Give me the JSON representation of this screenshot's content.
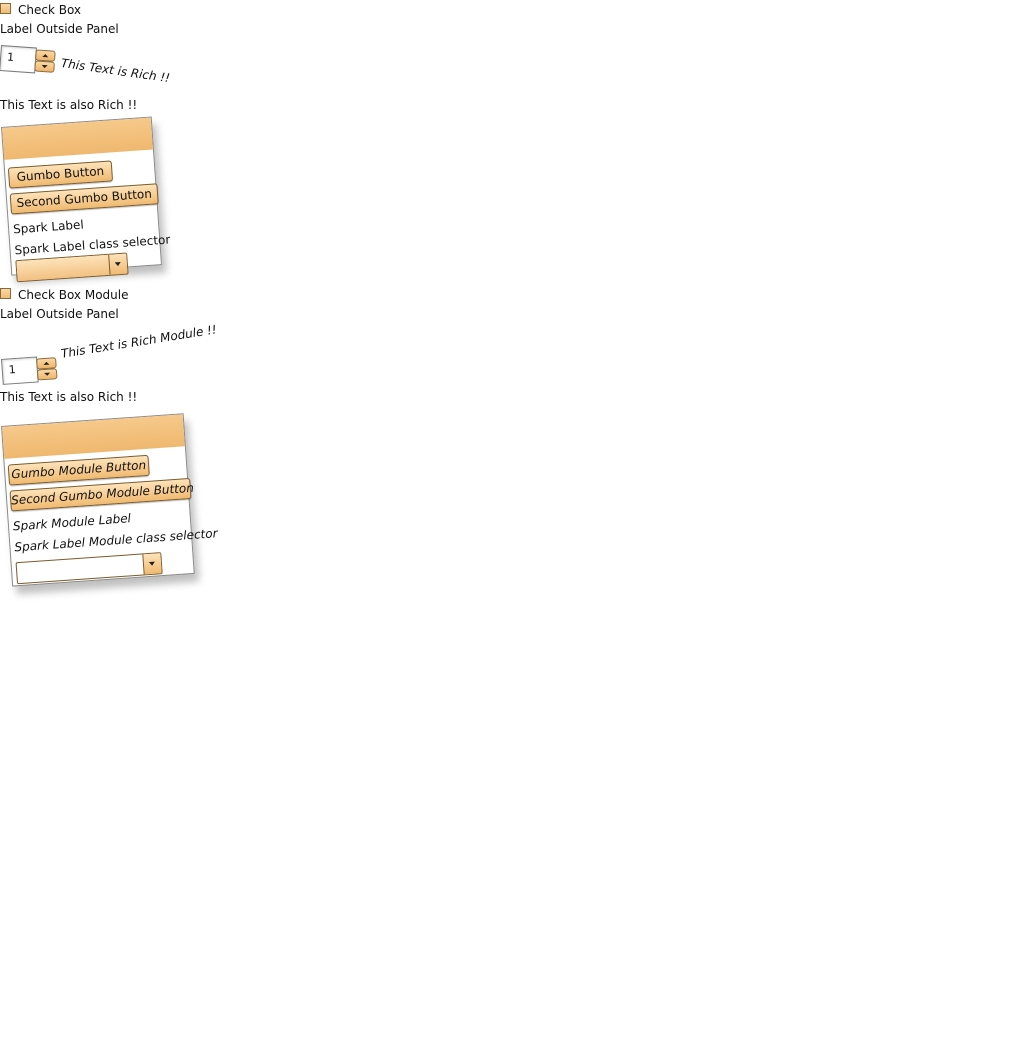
{
  "section1": {
    "checkbox_label": "Check Box",
    "label_outside": "Label Outside Panel",
    "stepper_value": "1",
    "rich_text": "This Text is Rich !!",
    "rich_text_also": "This Text is also Rich !!",
    "panel": {
      "button1": "Gumbo Button",
      "button2": "Second Gumbo Button",
      "spark_label": "Spark Label",
      "spark_label_class": "Spark Label class selector"
    }
  },
  "section2": {
    "checkbox_label": "Check Box Module",
    "label_outside": "Label Outside Panel",
    "stepper_value": "1",
    "rich_text": "This Text is Rich Module !!",
    "rich_text_also": "This Text is also Rich !!",
    "panel": {
      "button1": "Gumbo Module Button",
      "button2": "Second Gumbo Module Button",
      "spark_label": "Spark Module Label",
      "spark_label_class": "Spark Label Module class selector"
    }
  },
  "colors": {
    "accent": "#f2be7a",
    "border": "#8a6a3a"
  },
  "icons": {
    "stepper_up": "chevron-up-icon",
    "stepper_down": "chevron-down-icon",
    "combo_arrow": "chevron-down-icon"
  }
}
